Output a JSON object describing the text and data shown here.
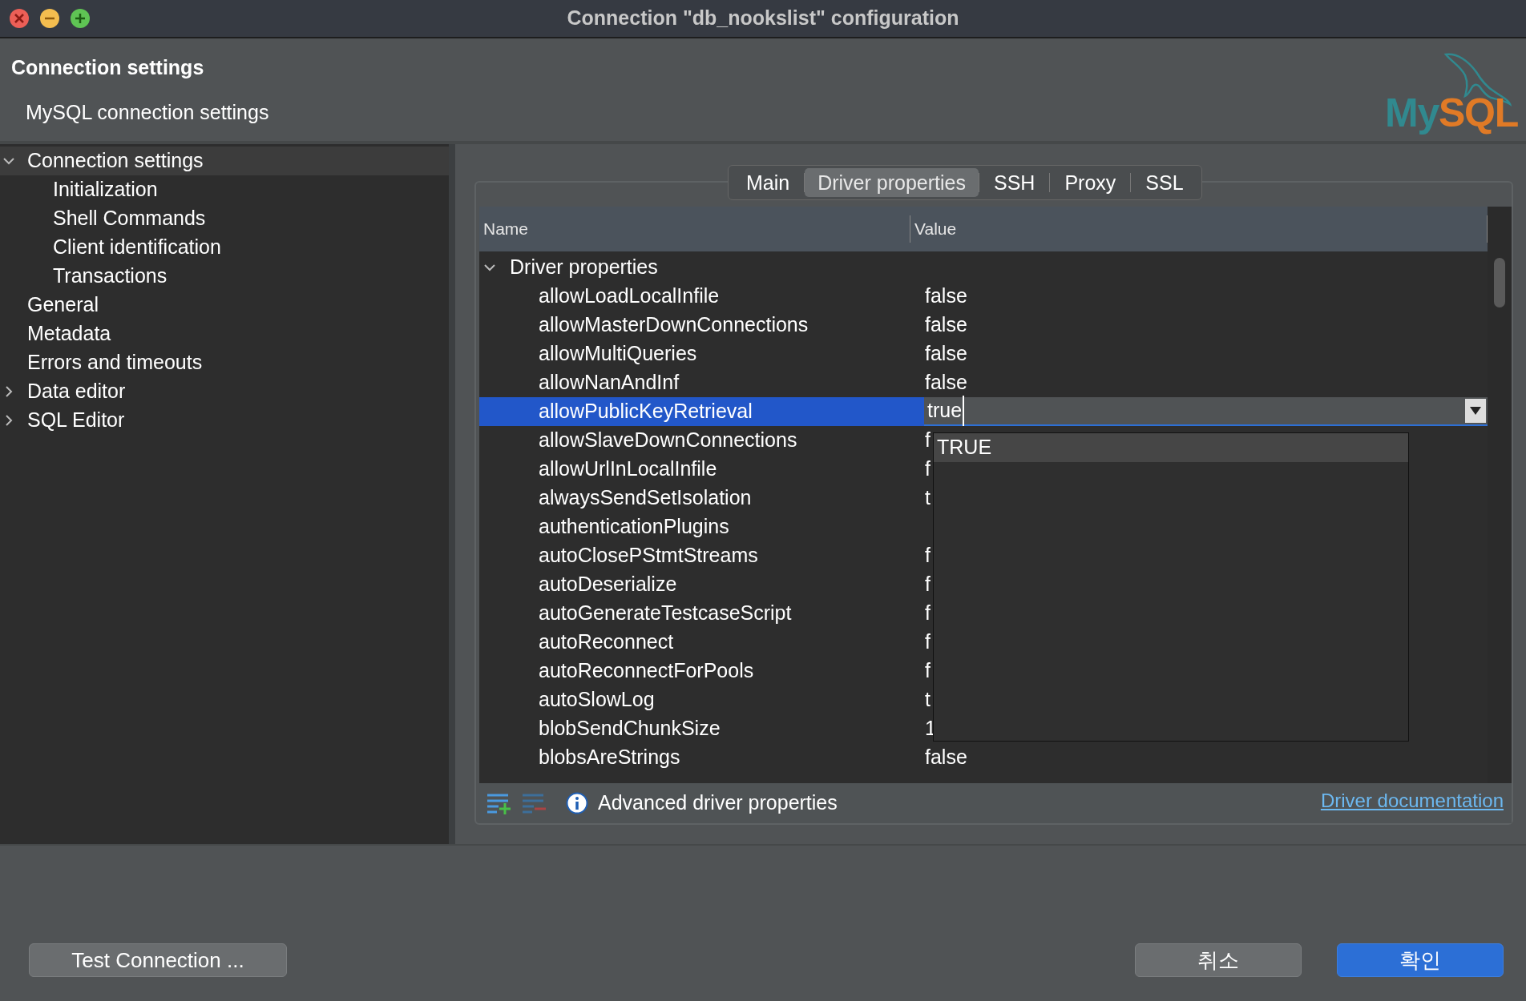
{
  "window": {
    "title": "Connection \"db_nookslist\" configuration"
  },
  "header": {
    "title": "Connection settings",
    "subtitle": "MySQL connection settings",
    "wordmark": [
      "My",
      "SQL"
    ]
  },
  "sidebar": {
    "items": [
      {
        "label": "Connection settings",
        "expanded": true,
        "selected": true,
        "children": [
          {
            "label": "Initialization"
          },
          {
            "label": "Shell Commands"
          },
          {
            "label": "Client identification"
          },
          {
            "label": "Transactions"
          }
        ]
      },
      {
        "label": "General"
      },
      {
        "label": "Metadata"
      },
      {
        "label": "Errors and timeouts"
      },
      {
        "label": "Data editor",
        "expanded": false
      },
      {
        "label": "SQL Editor",
        "expanded": false
      }
    ]
  },
  "tabs": [
    {
      "label": "Main",
      "selected": false
    },
    {
      "label": "Driver properties",
      "selected": true
    },
    {
      "label": "SSH",
      "selected": false
    },
    {
      "label": "Proxy",
      "selected": false
    },
    {
      "label": "SSL",
      "selected": false
    }
  ],
  "table": {
    "columns": [
      "Name",
      "Value"
    ],
    "group": {
      "label": "Driver properties",
      "expanded": true
    },
    "rows": [
      {
        "name": "allowLoadLocalInfile",
        "value": "false",
        "selected": false
      },
      {
        "name": "allowMasterDownConnections",
        "value": "false",
        "selected": false
      },
      {
        "name": "allowMultiQueries",
        "value": "false",
        "selected": false
      },
      {
        "name": "allowNanAndInf",
        "value": "false",
        "selected": false
      },
      {
        "name": "allowPublicKeyRetrieval",
        "value": "true",
        "selected": true
      },
      {
        "name": "allowSlaveDownConnections",
        "value": "f",
        "selected": false
      },
      {
        "name": "allowUrlInLocalInfile",
        "value": "f",
        "selected": false
      },
      {
        "name": "alwaysSendSetIsolation",
        "value": "t",
        "selected": false
      },
      {
        "name": "authenticationPlugins",
        "selected": false
      },
      {
        "name": "autoClosePStmtStreams",
        "value": "f",
        "selected": false
      },
      {
        "name": "autoDeserialize",
        "value": "f",
        "selected": false
      },
      {
        "name": "autoGenerateTestcaseScript",
        "value": "f",
        "selected": false
      },
      {
        "name": "autoReconnect",
        "value": "f",
        "selected": false
      },
      {
        "name": "autoReconnectForPools",
        "value": "f",
        "selected": false
      },
      {
        "name": "autoSlowLog",
        "value": "t",
        "selected": false
      },
      {
        "name": "blobSendChunkSize",
        "value": "1",
        "selected": false
      },
      {
        "name": "blobsAreStrings",
        "value": "false",
        "selected": false
      }
    ],
    "dropdown": {
      "options": [
        {
          "label": "TRUE",
          "selected": true
        }
      ]
    }
  },
  "table_footer": {
    "info": "Advanced driver properties",
    "link": "Driver documentation"
  },
  "buttons": {
    "test": "Test Connection ...",
    "cancel": "취소",
    "ok": "확인"
  }
}
